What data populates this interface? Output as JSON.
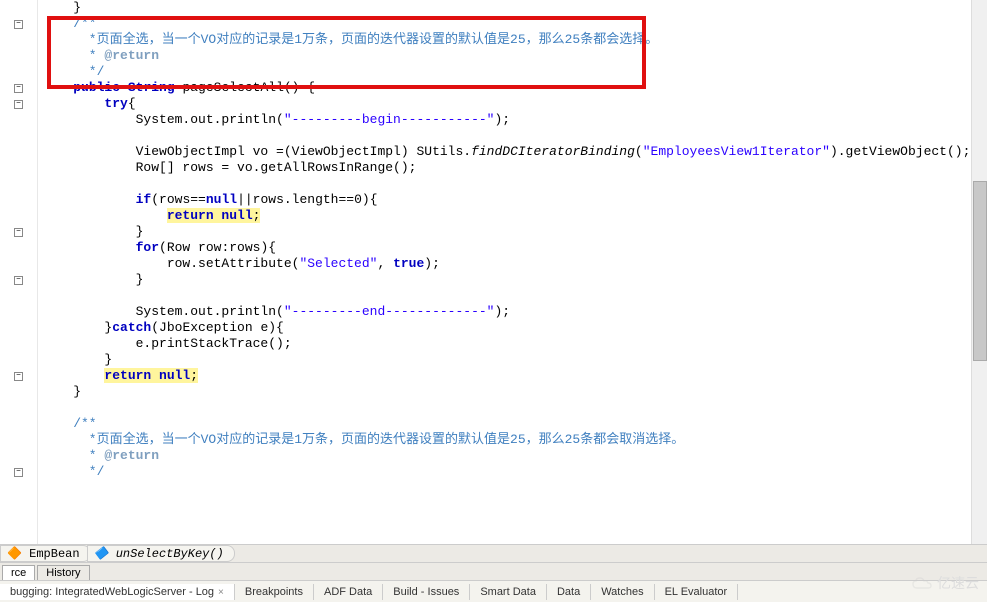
{
  "code": {
    "l0": "    }",
    "l1": "    /**",
    "l2": "      *页面全选，当一个VO对应的记录是1万条，页面的迭代器设置的默认值是25，那么25条都会选择。",
    "l3": "      * @return",
    "l4": "      */",
    "l5_kw1": "public",
    "l5_type": "String",
    "l5_rest": " pageSelectAll() {",
    "l6_kw": "try",
    "l6_rest": "{",
    "l7_pre": "            System.out.println(",
    "l7_str": "\"---------begin-----------\"",
    "l7_post": ");",
    "l8": "",
    "l9_pre": "            ViewObjectImpl vo =(ViewObjectImpl) SUtils.",
    "l9_method": "findDCIteratorBinding",
    "l9_mid": "(",
    "l9_str": "\"EmployeesView1Iterator\"",
    "l9_post": ").getViewObject();",
    "l10": "            Row[] rows = vo.getAllRowsInRange();",
    "l11": "",
    "l12_kw": "if",
    "l12_pre": "(rows==",
    "l12_null": "null",
    "l12_mid": "||rows.length==",
    "l12_zero": "0",
    "l12_post": "){",
    "l13_kw": "return null",
    "l13_post": ";",
    "l14": "            }",
    "l15_kw": "for",
    "l15_rest": "(Row row:rows){",
    "l16_pre": "                row.setAttribute(",
    "l16_str1": "\"Selected\"",
    "l16_mid": ", ",
    "l16_true": "true",
    "l16_post": ");",
    "l17": "            }",
    "l18": "",
    "l19_pre": "            System.out.println(",
    "l19_str": "\"---------end-------------\"",
    "l19_post": ");",
    "l20_kw": "catch",
    "l20_pre": "        }",
    "l20_rest": "(JboException e){",
    "l21": "            e.printStackTrace();",
    "l22": "        }",
    "l23_kw": "return null",
    "l23_post": ";",
    "l24": "    }",
    "l25": "",
    "l26": "    /**",
    "l27": "      *页面全选，当一个VO对应的记录是1万条，页面的迭代器设置的默认值是25，那么25条都会取消选择。",
    "l28": "      * @return",
    "l29": "      */"
  },
  "fold_minus": "−",
  "breadcrumb": {
    "item1": "EmpBean",
    "item2": "unSelectByKey()"
  },
  "source_tabs": {
    "source": "rce",
    "history": "History"
  },
  "bottom": {
    "tab1": "bugging: IntegratedWebLogicServer - Log",
    "tab2": "Breakpoints",
    "tab3": "ADF Data",
    "tab4": "Build - Issues",
    "tab5": "Smart Data",
    "tab6": "Data",
    "tab7": "Watches",
    "tab8": "EL Evaluator"
  },
  "watermark": "亿速云"
}
